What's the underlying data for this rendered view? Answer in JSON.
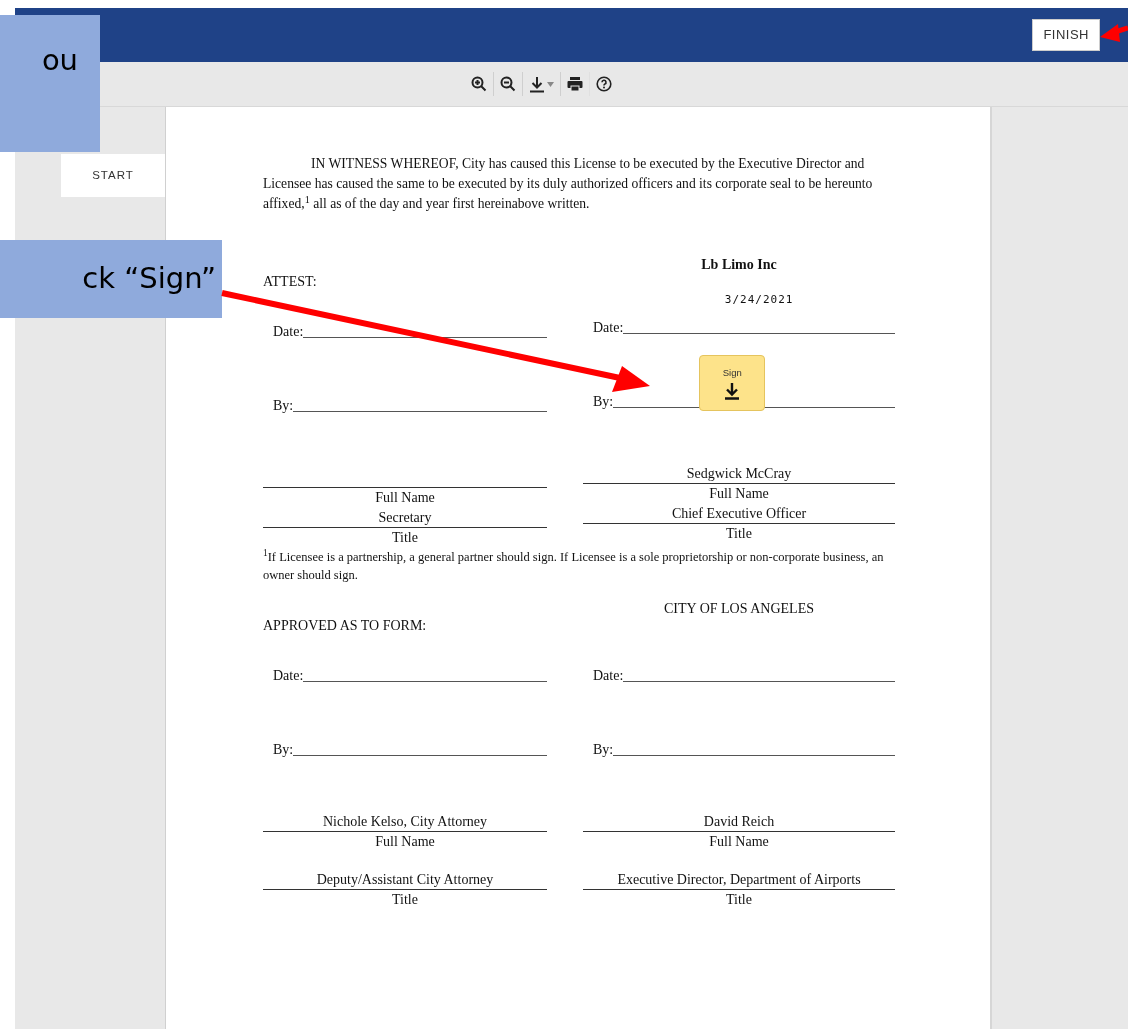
{
  "callouts": [
    {
      "text": "ou"
    },
    {
      "text": "ck “Sign”"
    }
  ],
  "header": {
    "finish_button": "FINISH"
  },
  "sidebar": {
    "start_tab": "START"
  },
  "document": {
    "paragraph": "IN WITNESS WHEREOF, City has caused this License to be executed by the Executive Director and Licensee has caused the same to be executed by its duly authorized officers and its corporate seal to be hereunto affixed,$^{1}$ all as of the day and year first hereinabove written.",
    "sections": [
      {
        "columns": [
          {
            "heading": "ATTEST:",
            "heading_bold": false,
            "date_label": "Date:",
            "by_label": "By:",
            "fields": [
              {
                "caption": "Full Name"
              },
              {
                "value": "Secretary",
                "caption": "Title"
              }
            ]
          },
          {
            "heading": "Lb Limo Inc",
            "heading_bold": true,
            "date_label": "Date:",
            "date_value": "3/24/2021",
            "by_label": "By:",
            "sign_button": "Sign",
            "fields": [
              {
                "value": "Sedgwick McCray",
                "caption": "Full Name"
              },
              {
                "value": "Chief Executive Officer",
                "caption": "Title"
              }
            ]
          }
        ],
        "footnote": "$^{1}$If Licensee is a partnership, a general partner should sign.  If Licensee is a sole proprietorship or non-corporate business, an owner should sign."
      },
      {
        "columns": [
          {
            "heading": "APPROVED AS TO FORM:",
            "heading_bold": false,
            "date_label": "Date:",
            "by_label": "By:",
            "fields": [
              {
                "value": "Nichole Kelso, City Attorney",
                "caption": "Full Name"
              },
              {
                "value": "Deputy/Assistant City Attorney",
                "caption": "Title"
              }
            ]
          },
          {
            "heading": "CITY OF LOS ANGELES",
            "heading_bold": false,
            "date_label": "Date:",
            "by_label": "By:",
            "fields": [
              {
                "value": "David Reich",
                "caption": "Full Name"
              },
              {
                "value": "Executive Director, Department of Airports",
                "caption": "Title"
              }
            ]
          }
        ]
      }
    ]
  }
}
